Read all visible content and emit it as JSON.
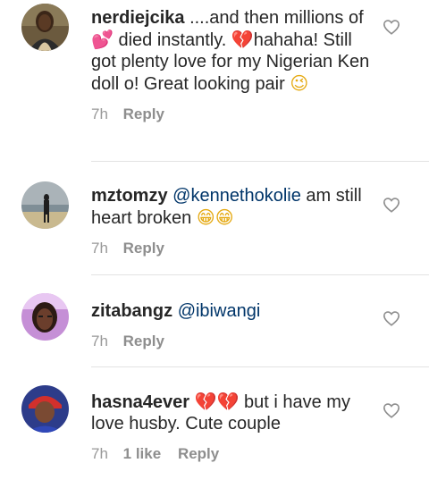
{
  "comments": [
    {
      "username": "nerdiejcika",
      "text_parts": [
        " ....and then millions of ",
        " died instantly. ",
        "hahaha! Still got plenty love for my Nigerian Ken doll o! Great looking pair "
      ],
      "emoji": [
        "two-hearts",
        "broken-heart",
        "smiling-face"
      ],
      "time": "7h",
      "likes": "",
      "reply_label": "Reply"
    },
    {
      "username": "mztomzy",
      "mention": "@kennethokolie",
      "text": " am still heart broken ",
      "emoji": [
        "grinning-face",
        "grinning-face"
      ],
      "time": "7h",
      "likes": "",
      "reply_label": "Reply"
    },
    {
      "username": "zitabangz",
      "mention": "@ibiwangi",
      "text": "",
      "time": "7h",
      "likes": "",
      "reply_label": "Reply"
    },
    {
      "username": "hasna4ever",
      "text": " but i have my love husby. Cute couple",
      "emoji": [
        "broken-heart",
        "broken-heart"
      ],
      "time": "7h",
      "likes": "1 like",
      "reply_label": "Reply"
    }
  ],
  "icons": {
    "like": "heart-outline-icon"
  },
  "colors": {
    "mention": "#003569",
    "meta": "#8e8e8e",
    "divider": "#e3e3e3"
  }
}
